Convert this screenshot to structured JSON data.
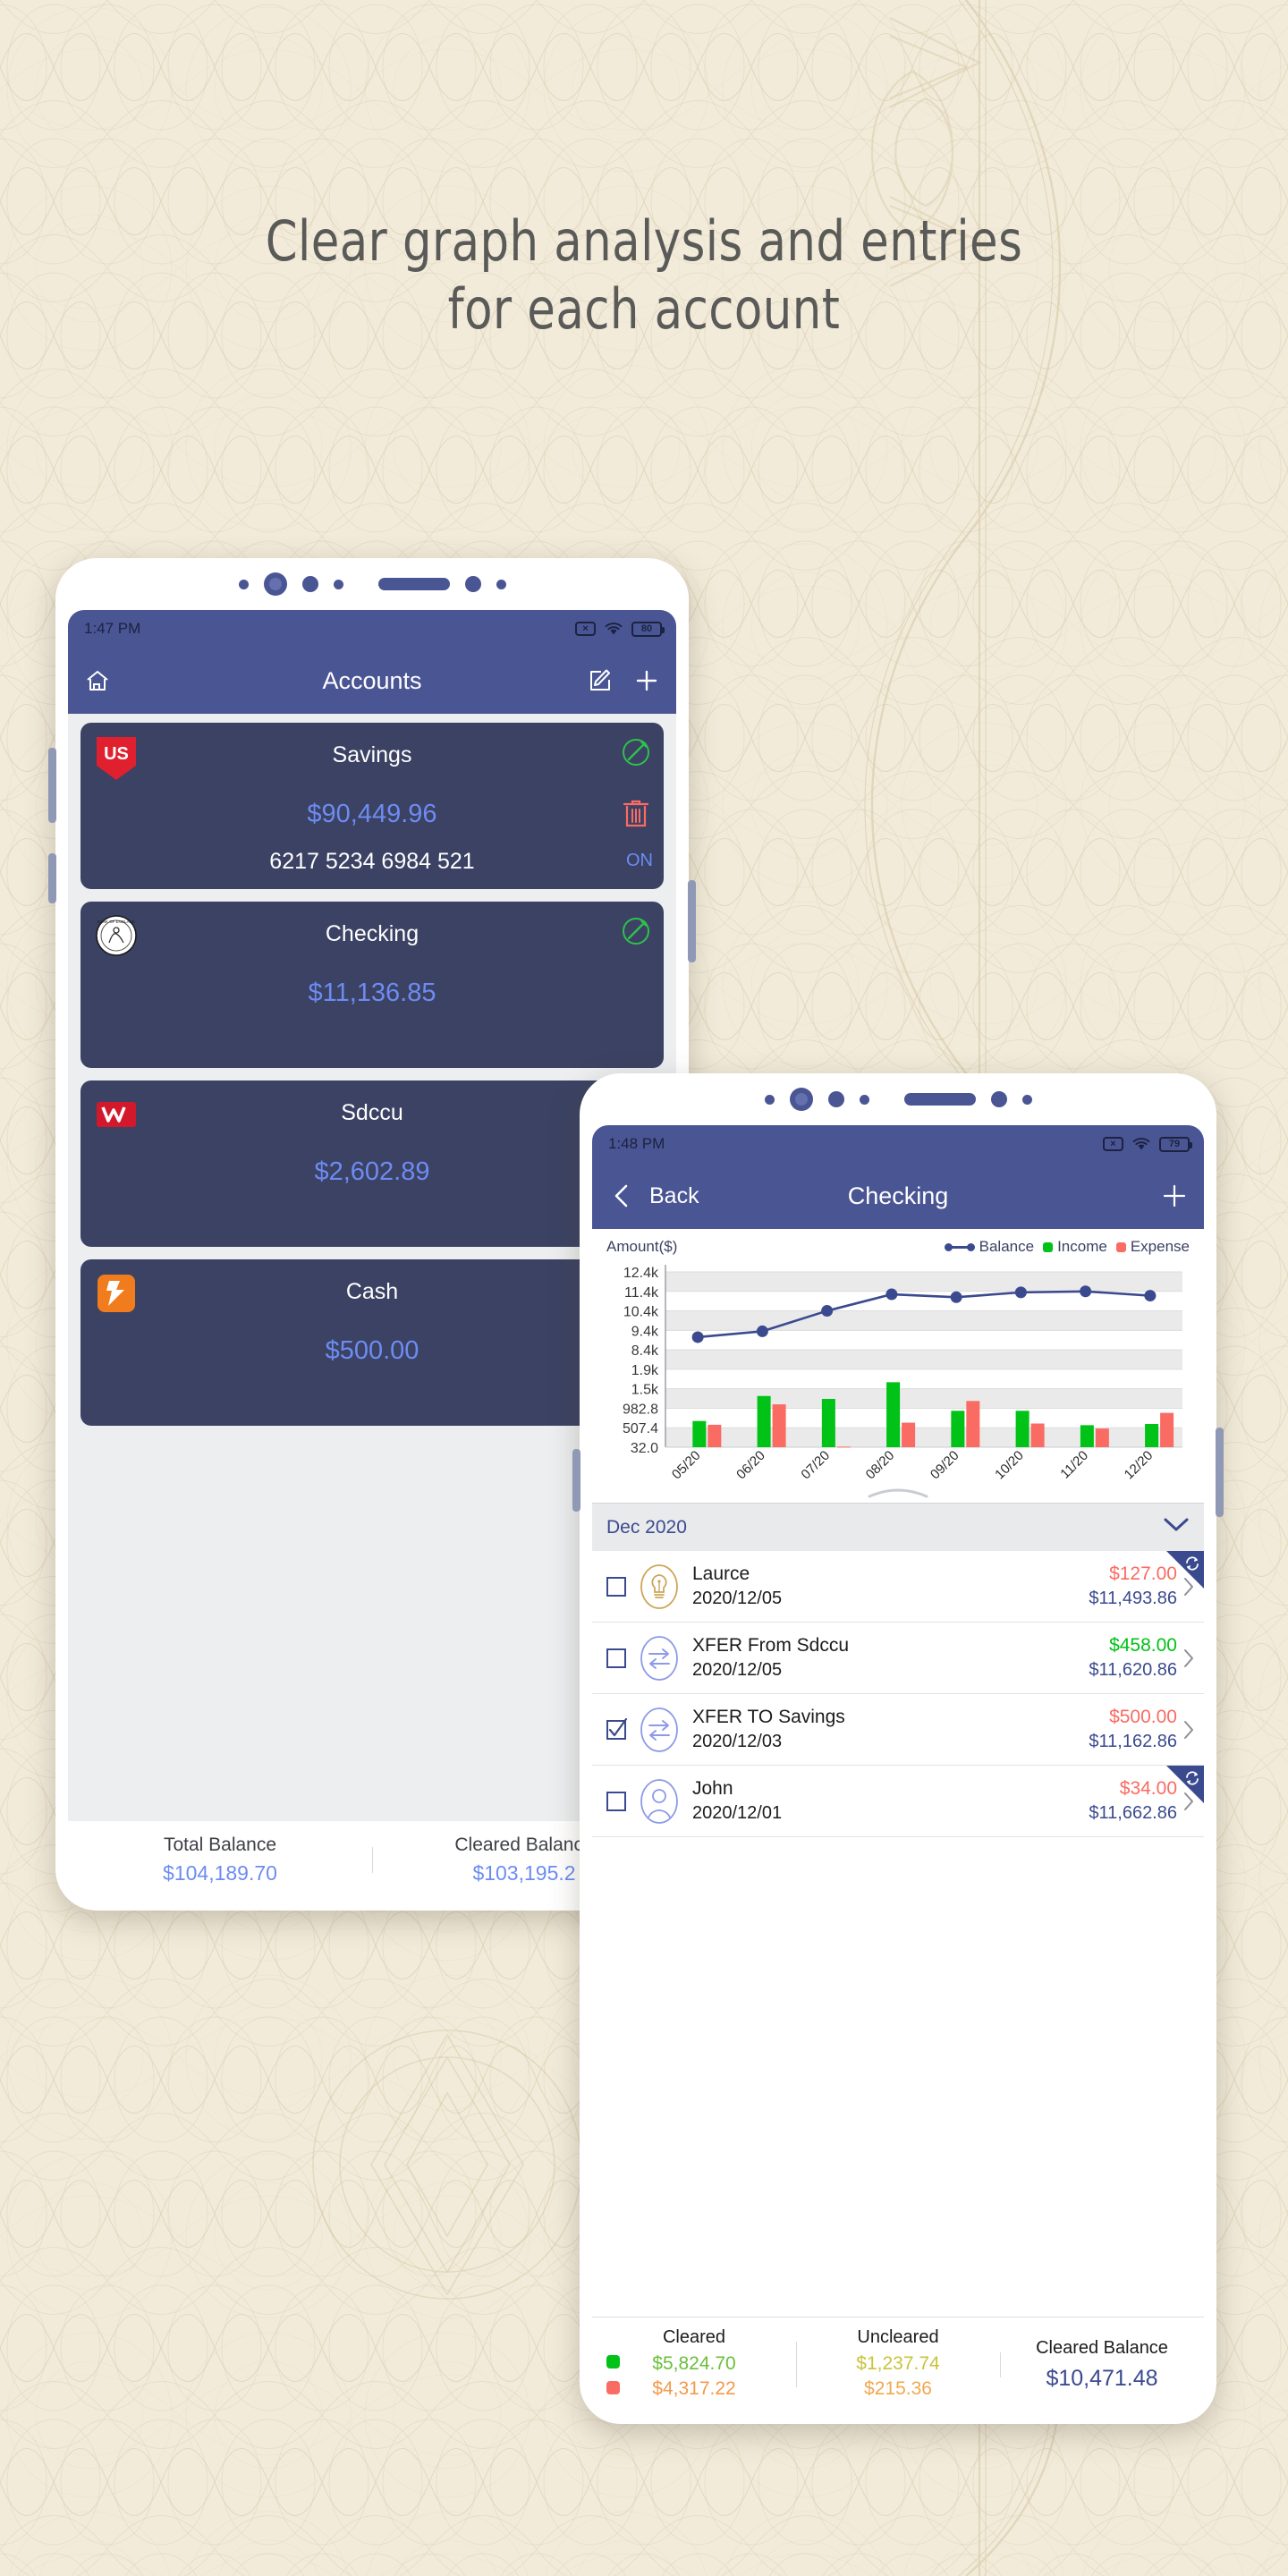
{
  "headline": {
    "line1": "Clear graph analysis and entries",
    "line2": "for each account"
  },
  "colors": {
    "primary": "#4a5594",
    "card": "#3b4263",
    "balance_blue": "#6d8cf2",
    "accent_blue": "#3b4a8f",
    "income_green": "#00c217",
    "expense_red": "#fa6b63",
    "background": "#f2ebda"
  },
  "phone1": {
    "status": {
      "time": "1:47 PM",
      "sim_icon": "no-sim-icon",
      "wifi_icon": "wifi-icon",
      "battery": "80"
    },
    "appbar": {
      "title": "Accounts",
      "home_icon": "home-icon",
      "edit_icon": "edit-square-icon",
      "add_icon": "plus-icon"
    },
    "accounts": [
      {
        "name": "Savings",
        "balance": "$90,449.96",
        "number": "6217 5234 6984 521",
        "status": "ON",
        "bank": "us-bank-logo",
        "edit_icon": "edit-circle-icon",
        "delete_icon": "trash-icon"
      },
      {
        "name": "Checking",
        "balance": "$11,136.85",
        "number": "",
        "status": "",
        "bank": "coin-logo",
        "edit_icon": "edit-circle-icon",
        "delete_icon": ""
      },
      {
        "name": "Sdccu",
        "balance": "$2,602.89",
        "number": "",
        "status": "",
        "bank": "westpac-logo",
        "edit_icon": "",
        "delete_icon": ""
      },
      {
        "name": "Cash",
        "balance": "$500.00",
        "number": "",
        "status": "",
        "bank": "cash-logo",
        "edit_icon": "",
        "delete_icon": ""
      }
    ],
    "totals": [
      {
        "label": "Total Balance",
        "value": "$104,189.70"
      },
      {
        "label": "Cleared Balance",
        "value": "$103,195.2"
      }
    ]
  },
  "phone2": {
    "status": {
      "time": "1:48 PM",
      "sim_icon": "no-sim-icon",
      "wifi_icon": "wifi-icon",
      "battery": "79"
    },
    "appbar": {
      "back_label": "Back",
      "back_icon": "chevron-left-icon",
      "title": "Checking",
      "add_icon": "plus-icon"
    },
    "chart_header": {
      "y_axis_label": "Amount($)",
      "legend": [
        {
          "label": "Balance",
          "type": "line",
          "color": "#3b4a8f"
        },
        {
          "label": "Income",
          "type": "dot",
          "color": "#00c217"
        },
        {
          "label": "Expense",
          "type": "dot",
          "color": "#fa6b63"
        }
      ]
    },
    "month_header": {
      "label": "Dec 2020",
      "chevron_icon": "chevron-down-icon"
    },
    "transactions": [
      {
        "title": "Laurce",
        "date": "2020/12/05",
        "amount": "$127.00",
        "amount_type": "expense",
        "balance": "$11,493.86",
        "checked": false,
        "avatar_icon": "lightbulb-icon",
        "recurring": true
      },
      {
        "title": "XFER From Sdccu",
        "date": "2020/12/05",
        "amount": "$458.00",
        "amount_type": "income",
        "balance": "$11,620.86",
        "checked": false,
        "avatar_icon": "transfer-icon",
        "recurring": false
      },
      {
        "title": "XFER TO Savings",
        "date": "2020/12/03",
        "amount": "$500.00",
        "amount_type": "expense",
        "balance": "$11,162.86",
        "checked": true,
        "avatar_icon": "transfer-icon",
        "recurring": false
      },
      {
        "title": "John",
        "date": "2020/12/01",
        "amount": "$34.00",
        "amount_type": "expense",
        "balance": "$11,662.86",
        "checked": false,
        "avatar_icon": "person-icon",
        "recurring": true
      }
    ],
    "summary": {
      "cleared_label": "Cleared",
      "cleared_income": "$5,824.70",
      "cleared_expense": "$4,317.22",
      "uncleared_label": "Uncleared",
      "uncleared_income": "$1,237.74",
      "uncleared_expense": "$215.36",
      "cleared_balance_label": "Cleared Balance",
      "cleared_balance_value": "$10,471.48"
    }
  },
  "chart_data": {
    "type": "line",
    "title": "",
    "xlabel": "",
    "ylabel": "Amount($)",
    "categories": [
      "05/20",
      "06/20",
      "07/20",
      "08/20",
      "09/20",
      "10/20",
      "11/20",
      "12/20"
    ],
    "ytick_labels": [
      "12.4k",
      "11.4k",
      "10.4k",
      "9.4k",
      "8.4k",
      "1.9k",
      "1.5k",
      "982.8",
      "507.4",
      "32.0"
    ],
    "ytick_values": [
      12400,
      11400,
      10400,
      9400,
      8400,
      1900,
      1500,
      982.8,
      507.4,
      32.0
    ],
    "series": [
      {
        "name": "Balance",
        "type": "line",
        "color": "#3b4a8f",
        "values": [
          9050,
          9350,
          10400,
          11250,
          11100,
          11350,
          11400,
          11180
        ]
      },
      {
        "name": "Income",
        "type": "bar",
        "color": "#00c217",
        "values": [
          660,
          1260,
          1190,
          1590,
          905,
          905,
          560,
          590
        ]
      },
      {
        "name": "Expense",
        "type": "bar",
        "color": "#fa6b63",
        "values": [
          570,
          1060,
          45,
          620,
          1140,
          600,
          480,
          855
        ]
      }
    ],
    "legend_position": "top-right",
    "grid": true
  }
}
